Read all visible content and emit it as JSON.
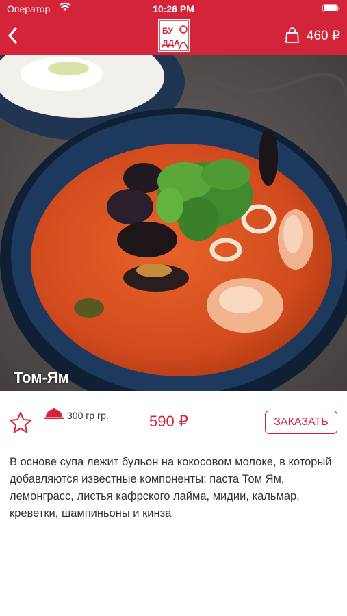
{
  "status_bar": {
    "carrier": "Оператор",
    "time": "10:26 PM"
  },
  "header": {
    "logo_text": "БУДДА",
    "cart_total": "460 ₽"
  },
  "dish": {
    "title": "Том-Ям",
    "weight": "300 гр гр.",
    "price": "590 ₽",
    "order_label": "ЗАКАЗАТЬ",
    "description": "В основе супа лежит бульон на кокосовом молоке, в который добавляются известные компоненты: паста Том Ям, лемонграсс, листья кафрского лайма, мидии, кальмар, креветки, шампиньоны и кинза"
  },
  "colors": {
    "accent": "#d4243a"
  },
  "icons": [
    "wifi-icon",
    "battery-icon",
    "back-chevron-icon",
    "shopping-bag-icon",
    "star-icon",
    "cloche-icon"
  ]
}
